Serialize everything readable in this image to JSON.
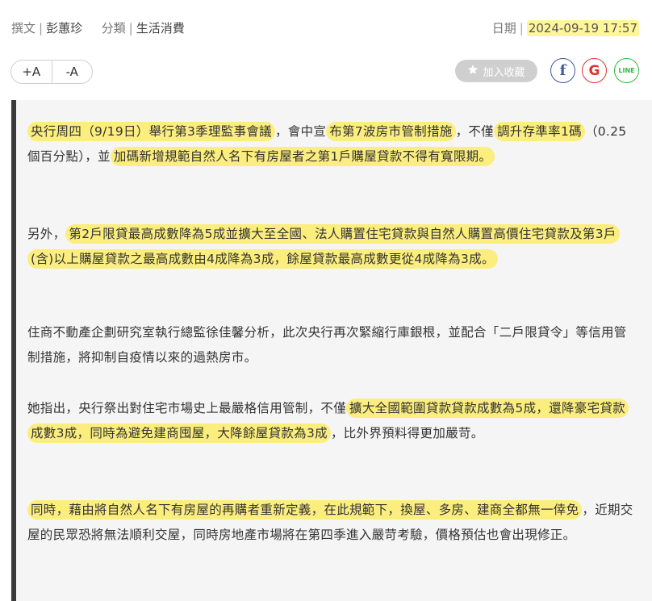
{
  "meta": {
    "author_label": "撰文",
    "author": "彭蕙珍",
    "category_label": "分類",
    "category": "生活消費",
    "date_label": "日期",
    "date": "2024-09-19 17:57"
  },
  "toolbar": {
    "font_increase": "+A",
    "font_decrease": "-A",
    "favorite_label": "加入收藏",
    "facebook": "f",
    "google": "G",
    "line": "LINE"
  },
  "article": {
    "p1": {
      "a": "央行周四（9/19日）舉行第3季理監事會議",
      "b": "，會中宣",
      "c": "布第7波房市管制措施",
      "d": "，不僅",
      "e": "調升存準率1碼",
      "f": "（0.25個百分點），並",
      "g": "加碼新增規範自然人名下有房屋者之第1戶購屋貸款不得有寬限期。"
    },
    "p2": {
      "a": "另外，",
      "b": "第2戶限貸最高成數降為5成並擴大至全國、法人購置住宅貸款與自然人購置高價住宅貸款及第3戶(含)以上購屋貸款之最高成數由4成降為3成，餘屋貸款最高成數更從4成降為3成。"
    },
    "p3": {
      "a": "住商不動產企劃研究室執行總監徐佳馨分析，此次央行再次緊縮行庫銀根，並配合「二戶限貸令」等信用管制措施，將抑制自疫情以來的過熱房市。"
    },
    "p4": {
      "a": "她指出，央行祭出對住宅市場史上最嚴格信用管制，不僅",
      "b": "擴大全國範圍貸款貸款成數為5成，還降豪宅貸款成數3成，同時為避免建商囤屋，大降餘屋貸款為3成",
      "c": "，比外界預料得更加嚴苛。"
    },
    "p5": {
      "a": "同時，藉由將自然人名下有房屋的再購者重新定義，在此規範下，換屋、多房、建商全都無一倖免",
      "b": "，近期交屋的民眾恐將無法順利交屋，同時房地產市場將在第四季進入嚴苛考驗，價格預估也會出現修正。"
    }
  },
  "colors": {
    "highlight": "#fbee7e",
    "facebook": "#3b5998",
    "google": "#dd3333",
    "line": "#2dbb3a",
    "favorite_bg": "#cfcfcf"
  }
}
